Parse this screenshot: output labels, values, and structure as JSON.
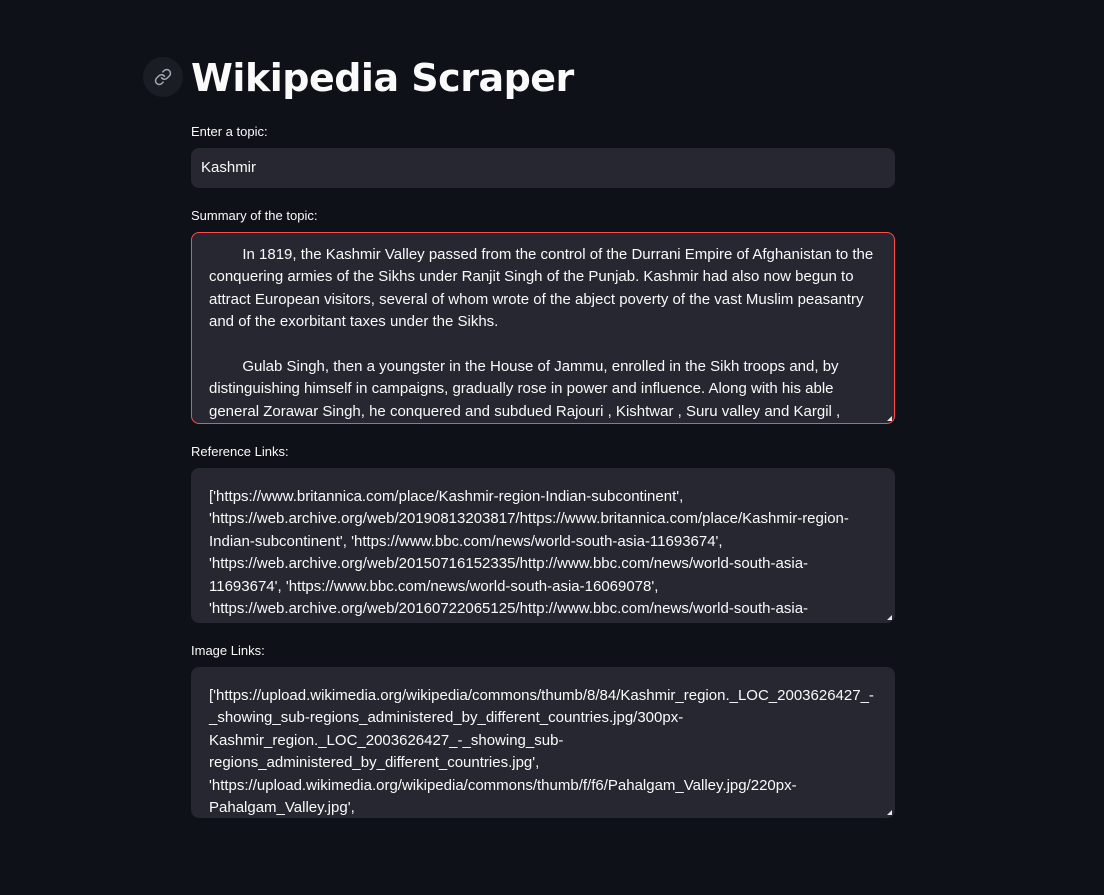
{
  "app": {
    "title": "Wikipedia Scraper",
    "anchor_icon": "link-icon"
  },
  "topic_input": {
    "label": "Enter a topic:",
    "value": "Kashmir"
  },
  "summary": {
    "label": "Summary of the topic:",
    "paragraphs": [
      "        In 1819, the Kashmir Valley passed from the control of the Durrani Empire of Afghanistan to the conquering armies of the Sikhs under Ranjit Singh of the Punjab. Kashmir had also now begun to attract European visitors, several of whom wrote of the abject poverty of the vast Muslim peasantry and of the exorbitant taxes under the Sikhs.",
      "        Gulab Singh, then a youngster in the House of Jammu, enrolled in the Sikh troops and, by distinguishing himself in campaigns, gradually rose in power and influence. Along with his able general Zorawar Singh, he conquered and subdued Rajouri , Kishtwar , Suru valley and Kargil ,"
    ]
  },
  "reference_links": {
    "label": "Reference Links:",
    "text": "['https://www.britannica.com/place/Kashmir-region-Indian-subcontinent', 'https://web.archive.org/web/20190813203817/https://www.britannica.com/place/Kashmir-region-Indian-subcontinent', 'https://www.bbc.com/news/world-south-asia-11693674', 'https://web.archive.org/web/20150716152335/http://www.bbc.com/news/world-south-asia-11693674', 'https://www.bbc.com/news/world-south-asia-16069078', 'https://web.archive.org/web/20160722065125/http://www.bbc.com/news/world-south-asia-"
  },
  "image_links": {
    "label": "Image Links:",
    "text": "['https://upload.wikimedia.org/wikipedia/commons/thumb/8/84/Kashmir_region._LOC_2003626427_-_showing_sub-regions_administered_by_different_countries.jpg/300px-Kashmir_region._LOC_2003626427_-_showing_sub-regions_administered_by_different_countries.jpg', 'https://upload.wikimedia.org/wikipedia/commons/thumb/f/f6/Pahalgam_Valley.jpg/220px-Pahalgam_Valley.jpg',"
  },
  "colors": {
    "background": "#0e1117",
    "widget_bg": "#262730",
    "focus_border": "#ff4b4b",
    "text": "#fafafa"
  }
}
